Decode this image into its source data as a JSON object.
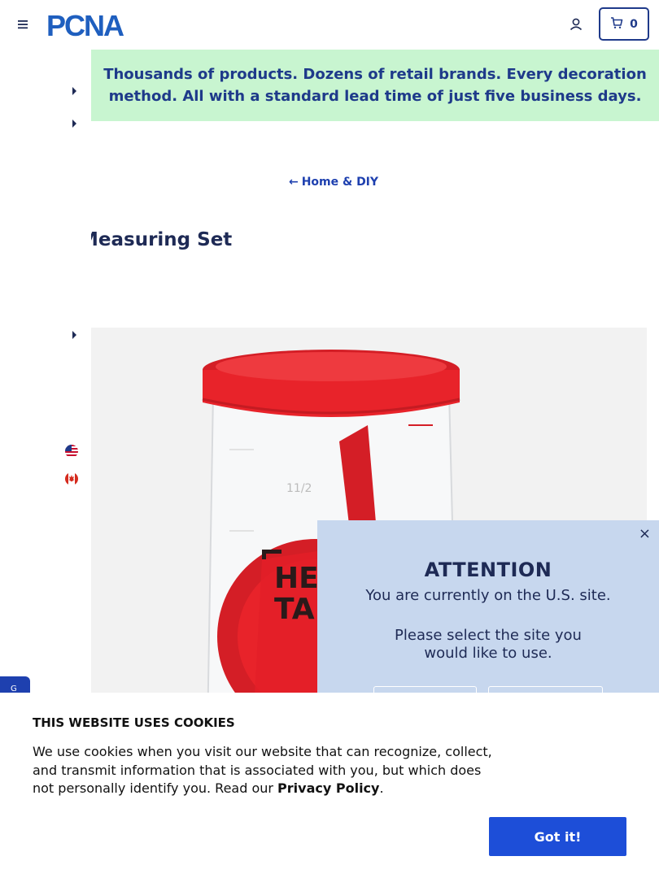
{
  "header": {
    "logo_text": "PCNA",
    "cart_count": "0"
  },
  "banner": {
    "text": "Thousands of products. Dozens of retail brands. Every decoration method. All with a standard lead time of just five business days."
  },
  "breadcrumb": {
    "arrow": "←",
    "label": "Home & DIY"
  },
  "product": {
    "title_visible": "Measuring Set"
  },
  "side_tab": {
    "label": "G"
  },
  "modal": {
    "close": "×",
    "title": "ATTENTION",
    "line1": "You are currently on the U.S. site.",
    "line2": "Please select the site you",
    "line3": "would like to use."
  },
  "cookie": {
    "title": "THIS WEBSITE USES COOKIES",
    "text_before": "We use cookies when you visit our website that can recognize, collect, and transmit information that is associated with you, but which does not personally identify you. Read our ",
    "link_text": "Privacy Policy",
    "text_after": ".",
    "button_label": "Got it!"
  },
  "colors": {
    "brand_blue": "#1f3a8a",
    "banner_green": "#c8f5d0",
    "modal_bg": "#c7d7ee",
    "button_blue": "#1d4ed8",
    "product_red": "#e8232a"
  }
}
